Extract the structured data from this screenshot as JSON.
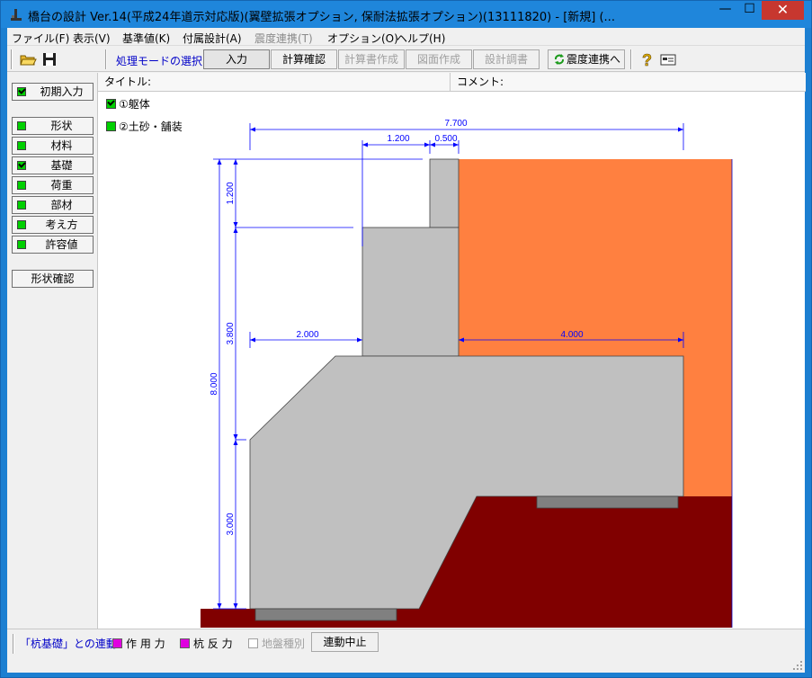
{
  "titlebar": {
    "title": "橋台の設計 Ver.14(平成24年道示対応版)(翼壁拡張オプション, 保耐法拡張オプション)(13111820) - [新規] (...",
    "minimize": "—",
    "maximize": "☐",
    "close": "✕"
  },
  "menu": [
    {
      "label": "ファイル(F)"
    },
    {
      "label": "表示(V)"
    },
    {
      "label": "基準値(K)"
    },
    {
      "label": "付属設計(A)"
    },
    {
      "label": "震度連携(T)"
    },
    {
      "label": "オプション(O)"
    },
    {
      "label": "ヘルプ(H)"
    }
  ],
  "toolbar": {
    "mode_label": "処理モードの選択",
    "input": "入力",
    "calc_confirm": "計算確認",
    "report": "計算書作成",
    "drawing": "図面作成",
    "design_doc": "設計調書",
    "seismic": "震度連携へ"
  },
  "sidebar": {
    "initial_input": "初期入力",
    "items": [
      {
        "label": "形状"
      },
      {
        "label": "材料"
      },
      {
        "label": "基礎"
      },
      {
        "label": "荷重"
      },
      {
        "label": "部材"
      },
      {
        "label": "考え方"
      },
      {
        "label": "許容値"
      }
    ],
    "shape_confirm": "形状確認"
  },
  "main": {
    "title_label": "タイトル:",
    "comment_label": "コメント:",
    "tree": [
      {
        "label": "①躯体"
      },
      {
        "label": "②土砂・舗装"
      }
    ]
  },
  "drawing": {
    "dims": {
      "total_width": "7.700",
      "parapet_offset": "1.200",
      "parapet_width": "0.500",
      "left_ext": "2.000",
      "right_ext": "4.000",
      "parapet_height": "1.200",
      "wall_height": "3.800",
      "total_height": "8.000",
      "footing_height": "3.000"
    },
    "colors": {
      "soil_fill": "#ff8040",
      "ground": "#800000",
      "concrete": "#c0c0c0",
      "dimension": "#0000ff"
    }
  },
  "status": {
    "link_label": "「杭基礎」との連動",
    "action_force": "作 用 力",
    "pile_reaction": "杭 反 力",
    "ground_spring": "地盤種別",
    "stop_link": "連動中止"
  }
}
